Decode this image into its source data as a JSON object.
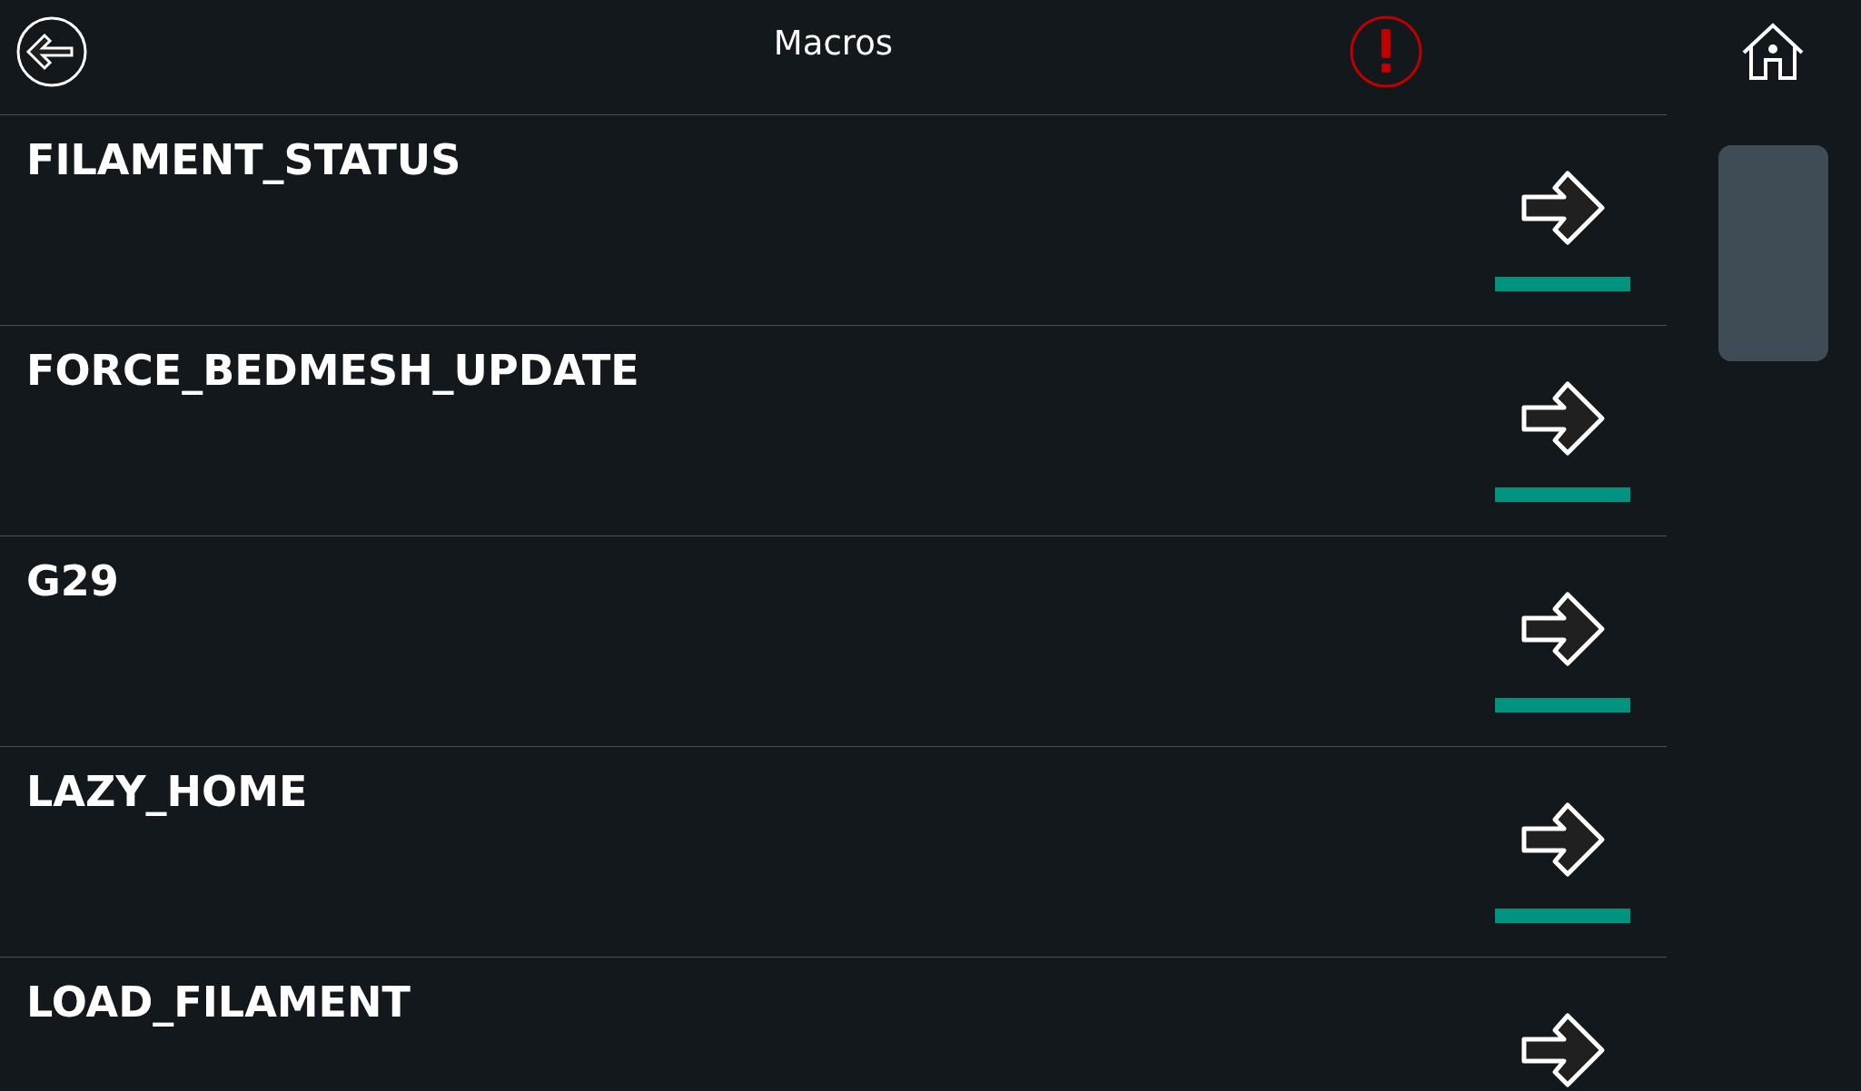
{
  "header": {
    "title": "Macros"
  },
  "macros": [
    {
      "name": "FILAMENT_STATUS"
    },
    {
      "name": "FORCE_BEDMESH_UPDATE"
    },
    {
      "name": "G29"
    },
    {
      "name": "LAZY_HOME"
    },
    {
      "name": "LOAD_FILAMENT"
    }
  ]
}
